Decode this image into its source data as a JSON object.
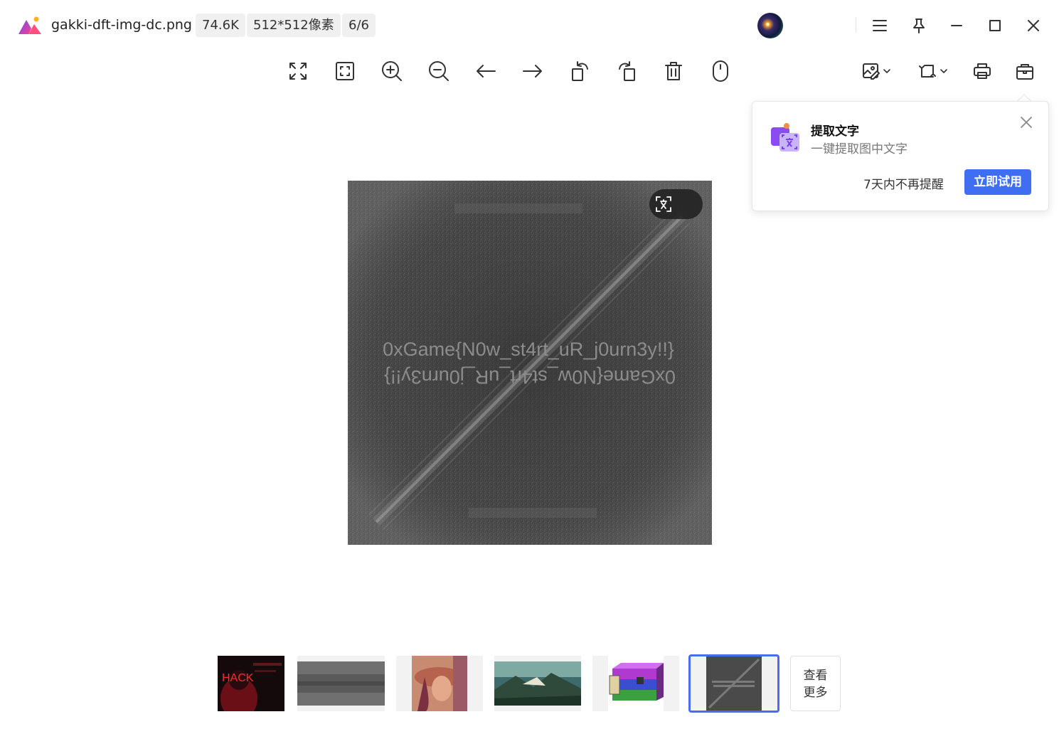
{
  "title_bar": {
    "file_name": "gakki-dft-img-dc.png",
    "file_size": "74.6K",
    "dimensions": "512*512像素",
    "position": "6/6"
  },
  "main_image": {
    "text_line_1": "0xGame{N0w_st4rt_uR_j0urn3y!!}",
    "text_line_2": "0xGame{N0w_st4rt_uR_j0urn3y!!}"
  },
  "popup": {
    "title": "提取文字",
    "subtitle": "一键提取图中文字",
    "remind_label": "7天内不再提醒",
    "try_label": "立即试用"
  },
  "thumbnails": {
    "thumb_1_text": "HACK",
    "more_label_line1": "查看",
    "more_label_line2": "更多"
  },
  "colors": {
    "accent": "#3f6ef3",
    "selection": "#4a6cf0"
  }
}
